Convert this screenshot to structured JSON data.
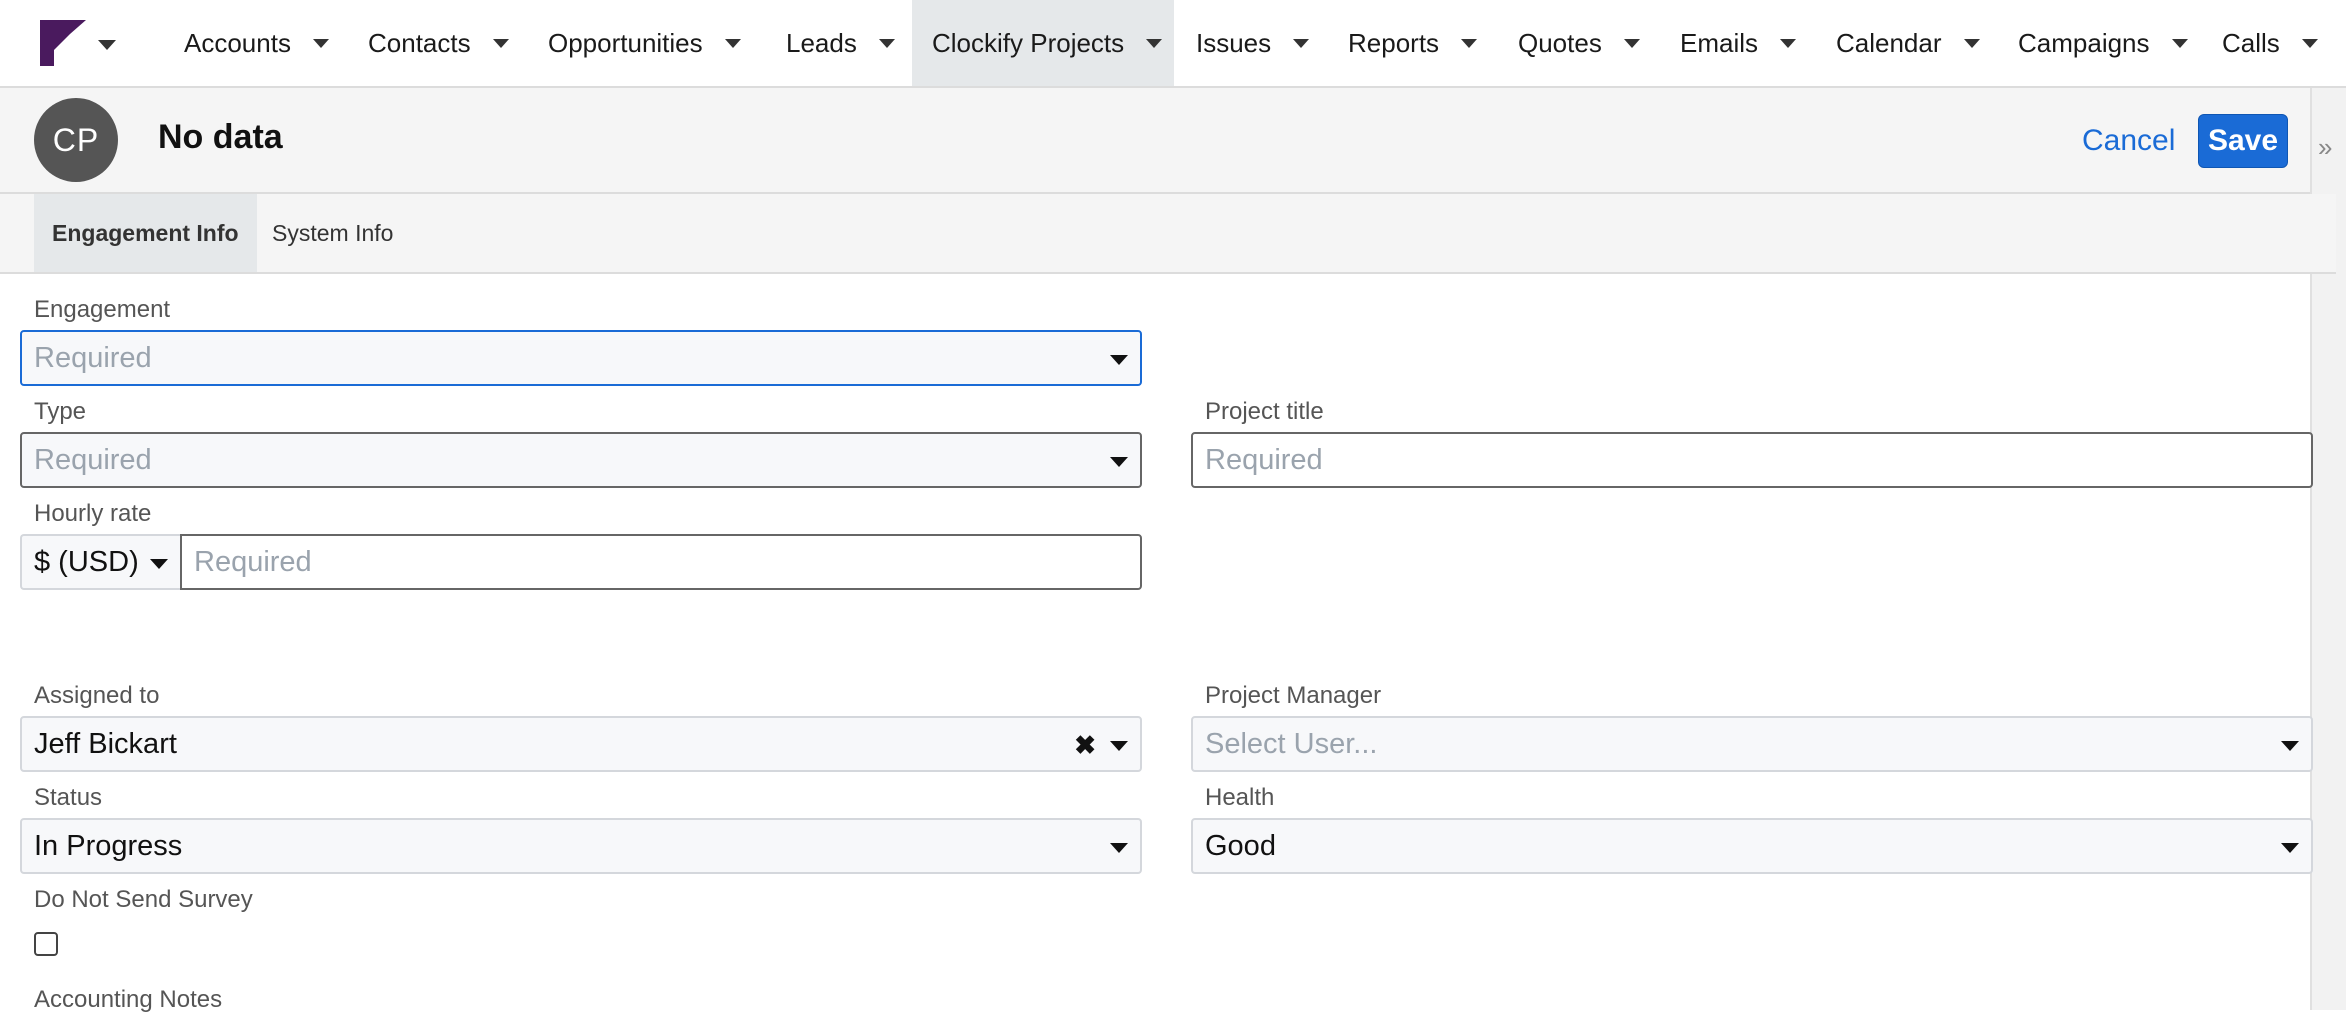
{
  "nav": {
    "items": [
      {
        "label": "Accounts"
      },
      {
        "label": "Contacts"
      },
      {
        "label": "Opportunities"
      },
      {
        "label": "Leads"
      },
      {
        "label": "Clockify Projects",
        "active": true
      },
      {
        "label": "Issues"
      },
      {
        "label": "Reports"
      },
      {
        "label": "Quotes"
      },
      {
        "label": "Emails"
      },
      {
        "label": "Calendar"
      },
      {
        "label": "Campaigns"
      },
      {
        "label": "Calls"
      }
    ]
  },
  "record": {
    "avatar_initials": "CP",
    "title": "No data",
    "cancel_label": "Cancel",
    "save_label": "Save"
  },
  "tabs": [
    {
      "label": "Engagement Info",
      "active": true
    },
    {
      "label": "System Info"
    }
  ],
  "form": {
    "engagement": {
      "label": "Engagement",
      "placeholder": "Required"
    },
    "type": {
      "label": "Type",
      "placeholder": "Required"
    },
    "project_title": {
      "label": "Project title",
      "placeholder": "Required"
    },
    "hourly_rate": {
      "label": "Hourly rate",
      "currency": "$ (USD)",
      "placeholder": "Required"
    },
    "assigned_to": {
      "label": "Assigned to",
      "value": "Jeff Bickart"
    },
    "project_manager": {
      "label": "Project Manager",
      "placeholder": "Select User..."
    },
    "status": {
      "label": "Status",
      "value": "In Progress"
    },
    "health": {
      "label": "Health",
      "value": "Good"
    },
    "do_not_send_survey": {
      "label": "Do Not Send Survey",
      "checked": false
    },
    "accounting_notes": {
      "label": "Accounting Notes"
    }
  },
  "colors": {
    "accent": "#1a6bd6",
    "brand": "#4a1a5e",
    "active_tab": "#e5e8ea"
  },
  "icons": {
    "logo": "sugarcrm-logo-icon",
    "dropdown": "chevron-down-icon",
    "clear": "close-icon",
    "expand": "double-chevron-right-icon"
  }
}
